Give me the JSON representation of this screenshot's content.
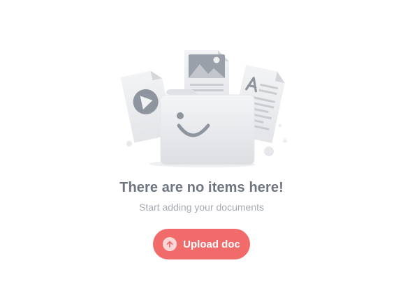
{
  "empty_state": {
    "title": "There are no items here!",
    "subtitle": "Start adding your documents",
    "illustration": {
      "icons": [
        "video-file-icon",
        "image-file-icon",
        "text-file-icon",
        "smiling-folder-icon"
      ]
    }
  },
  "upload_button": {
    "label": "Upload doc",
    "icon": "upload-arrow-icon"
  },
  "colors": {
    "accent": "#f26b6b",
    "title": "#6f7580",
    "subtitle": "#a6abb3"
  }
}
